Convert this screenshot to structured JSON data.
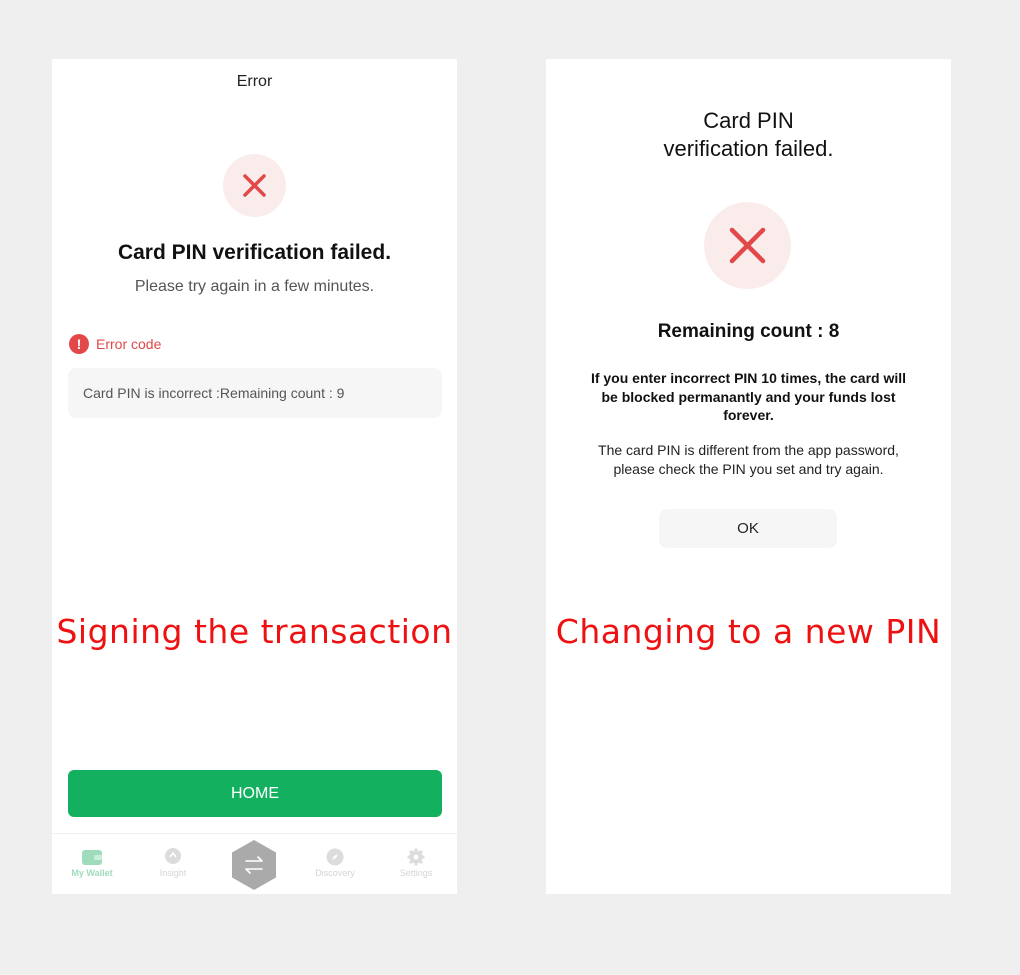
{
  "left_screen": {
    "header_title": "Error",
    "headline": "Card PIN verification failed.",
    "subtext": "Please try again in a few minutes.",
    "error_code_label": "Error code",
    "error_message": "Card PIN is incorrect :Remaining count : 9",
    "caption": "Signing the transaction",
    "home_button": "HOME",
    "tabs": [
      {
        "label": "My Wallet",
        "icon": "wallet-icon",
        "active": true
      },
      {
        "label": "Insight",
        "icon": "bulb-icon",
        "active": false
      },
      {
        "label": "",
        "icon": "swap-arrows-icon",
        "active": false
      },
      {
        "label": "Discovery",
        "icon": "compass-icon",
        "active": false
      },
      {
        "label": "Settings",
        "icon": "gear-icon",
        "active": false
      }
    ]
  },
  "right_screen": {
    "title_line1": "Card PIN",
    "title_line2": "verification failed.",
    "remaining": "Remaining count : 8",
    "warning": "If you enter incorrect PIN 10 times, the card will be blocked permanantly and your funds lost forever.",
    "info": "The card PIN is different from the app password, please check the PIN you set and try again.",
    "ok_button": "OK",
    "caption": "Changing to a new PIN"
  },
  "colors": {
    "error_red": "#e24848",
    "accent_green": "#13b15f",
    "caption_red": "#ee1111"
  }
}
